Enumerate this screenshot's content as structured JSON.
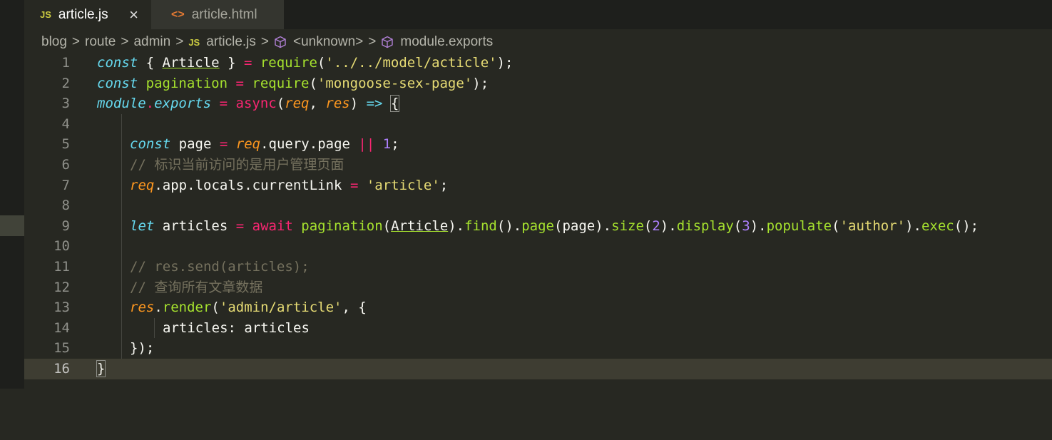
{
  "tabs": [
    {
      "icon": "JS",
      "label": "article.js",
      "close": "×"
    },
    {
      "icon": "<>",
      "label": "article.html"
    }
  ],
  "breadcrumb": {
    "items": [
      "blog",
      "route",
      "admin"
    ],
    "file_icon": "JS",
    "file": "article.js",
    "symbol1": "<unknown>",
    "symbol2": "module.exports",
    "sep": ">"
  },
  "editor": {
    "cursor_line": 16,
    "lines": [
      {
        "n": "1"
      },
      {
        "n": "2"
      },
      {
        "n": "3"
      },
      {
        "n": "4"
      },
      {
        "n": "5"
      },
      {
        "n": "6"
      },
      {
        "n": "7"
      },
      {
        "n": "8"
      },
      {
        "n": "9"
      },
      {
        "n": "10"
      },
      {
        "n": "11"
      },
      {
        "n": "12"
      },
      {
        "n": "13"
      },
      {
        "n": "14"
      },
      {
        "n": "15"
      },
      {
        "n": "16"
      }
    ],
    "tokens": {
      "const": "const",
      "let": "let",
      "open_brace_sp": "{ ",
      "close_brace_sp": " }",
      "Article": "Article",
      "eq": " = ",
      "require": "require",
      "lparen": "(",
      "rparen": ")",
      "semi": ";",
      "str_model": "'../../model/acticle'",
      "pagination": "pagination",
      "str_mongoose": "'mongoose-sex-page'",
      "module": "module",
      "dot": ".",
      "exports": "exports",
      "async": "async",
      "req": "req",
      "comma_sp": ", ",
      "res": "res",
      "arrow": " => ",
      "lbrace": "{",
      "rbrace": "}",
      "page": "page",
      "query": "query",
      "or": "||",
      "one": "1",
      "comment1": "// 标识当前访问的是用户管理页面",
      "app": "app",
      "locals": "locals",
      "currentLink": "currentLink",
      "str_article": "'article'",
      "articles": "articles",
      "await": "await",
      "find": "find",
      "size": "size",
      "two": "2",
      "display": "display",
      "three": "3",
      "populate": "populate",
      "str_author": "'author'",
      "exec": "exec",
      "comment2": "// res.send(articles);",
      "comment3": "// 查询所有文章数据",
      "render": "render",
      "str_admin_article": "'admin/article'",
      "articles_key": "articles: ",
      "close_obj": "});",
      "sp": " "
    }
  }
}
